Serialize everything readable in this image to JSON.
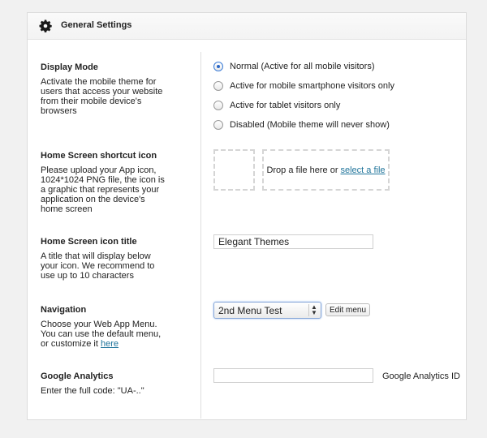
{
  "header": {
    "title": "General Settings",
    "icon": "gear-icon"
  },
  "display_mode": {
    "title": "Display Mode",
    "description": "Activate the mobile theme for users that access your website from their mobile device's browsers",
    "options": [
      {
        "label": "Normal (Active for all mobile visitors)",
        "checked": true
      },
      {
        "label": "Active for mobile smartphone visitors only",
        "checked": false
      },
      {
        "label": "Active for tablet visitors only",
        "checked": false
      },
      {
        "label": "Disabled (Mobile theme will never show)",
        "checked": false
      }
    ]
  },
  "shortcut_icon": {
    "title": "Home Screen shortcut icon",
    "description": "Please upload your App icon, 1024*1024 PNG file, the icon is a graphic that represents your application on the device's home screen",
    "drop_text": "Drop a file here or",
    "select_link": "select a file"
  },
  "icon_title": {
    "title": "Home Screen icon title",
    "description": "A title that will display below your icon. We recommend to use up to 10 characters",
    "value": "Elegant Themes"
  },
  "navigation": {
    "title": "Navigation",
    "description": "Choose your Web App Menu. You can use the default menu, or customize it",
    "link": "here",
    "selected": "2nd Menu Test",
    "edit_button": "Edit menu"
  },
  "analytics": {
    "title": "Google Analytics",
    "description": "Enter the full code: \"UA-..\"",
    "value": "",
    "label": "Google Analytics ID"
  }
}
